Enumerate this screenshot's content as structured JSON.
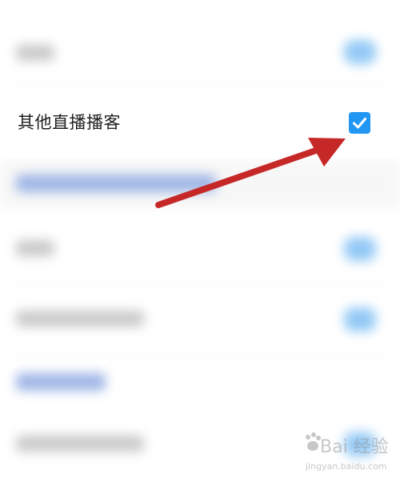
{
  "setting_row": {
    "label": "其他直播播客",
    "checked": true,
    "accent_color": "#2196f3"
  },
  "annotation": {
    "arrow_color": "#c62828"
  },
  "watermark": {
    "main": "Bai 经验",
    "sub": "jingyan.baidu.com"
  }
}
